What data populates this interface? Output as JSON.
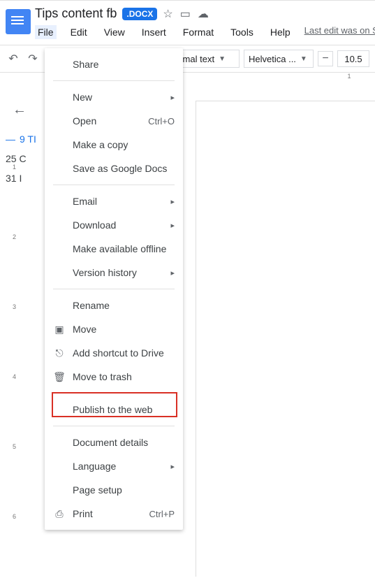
{
  "header": {
    "doc_title": "Tips content fb",
    "badge": ".DOCX",
    "last_edit": "Last edit was on Sept"
  },
  "menubar": {
    "items": [
      "File",
      "Edit",
      "View",
      "Insert",
      "Format",
      "Tools",
      "Help"
    ],
    "active_index": 0
  },
  "toolbar": {
    "style_label": "ormal text",
    "font_label": "Helvetica ...",
    "zoom_value": "10.5"
  },
  "outline": {
    "items": [
      {
        "label": "9 TI",
        "active": true
      },
      {
        "label": "25 C",
        "active": false
      },
      {
        "label": "31 I",
        "active": false
      }
    ]
  },
  "file_menu": {
    "items": [
      {
        "label": "Share",
        "icon": "",
        "shortcut": "",
        "sub": false
      },
      {
        "sep": true
      },
      {
        "label": "New",
        "icon": "",
        "shortcut": "",
        "sub": true
      },
      {
        "label": "Open",
        "icon": "",
        "shortcut": "Ctrl+O",
        "sub": false
      },
      {
        "label": "Make a copy",
        "icon": "",
        "shortcut": "",
        "sub": false
      },
      {
        "label": "Save as Google Docs",
        "icon": "",
        "shortcut": "",
        "sub": false
      },
      {
        "sep": true
      },
      {
        "label": "Email",
        "icon": "",
        "shortcut": "",
        "sub": true
      },
      {
        "label": "Download",
        "icon": "",
        "shortcut": "",
        "sub": true
      },
      {
        "label": "Make available offline",
        "icon": "",
        "shortcut": "",
        "sub": false
      },
      {
        "label": "Version history",
        "icon": "",
        "shortcut": "",
        "sub": true
      },
      {
        "sep": true
      },
      {
        "label": "Rename",
        "icon": "",
        "shortcut": "",
        "sub": false
      },
      {
        "label": "Move",
        "icon": "folder",
        "shortcut": "",
        "sub": false
      },
      {
        "label": "Add shortcut to Drive",
        "icon": "shortcut",
        "shortcut": "",
        "sub": false
      },
      {
        "label": "Move to trash",
        "icon": "trash",
        "shortcut": "",
        "sub": false
      },
      {
        "sep": true
      },
      {
        "label": "Publish to the web",
        "icon": "",
        "shortcut": "",
        "sub": false,
        "highlighted": true
      },
      {
        "sep": true
      },
      {
        "label": "Document details",
        "icon": "",
        "shortcut": "",
        "sub": false
      },
      {
        "label": "Language",
        "icon": "",
        "shortcut": "",
        "sub": true
      },
      {
        "label": "Page setup",
        "icon": "",
        "shortcut": "",
        "sub": false
      },
      {
        "label": "Print",
        "icon": "print",
        "shortcut": "Ctrl+P",
        "sub": false
      }
    ]
  },
  "icons": {
    "star": "☆",
    "move": "▭",
    "cloud": "☁",
    "undo": "↶",
    "redo": "↷",
    "minus": "−",
    "folder": "▣",
    "shortcut": "⎋",
    "trash": "🗑",
    "print": "⎙"
  },
  "ruler": {
    "h_label": "1",
    "v_labels": [
      "1",
      "2",
      "3",
      "4",
      "5",
      "6"
    ]
  }
}
